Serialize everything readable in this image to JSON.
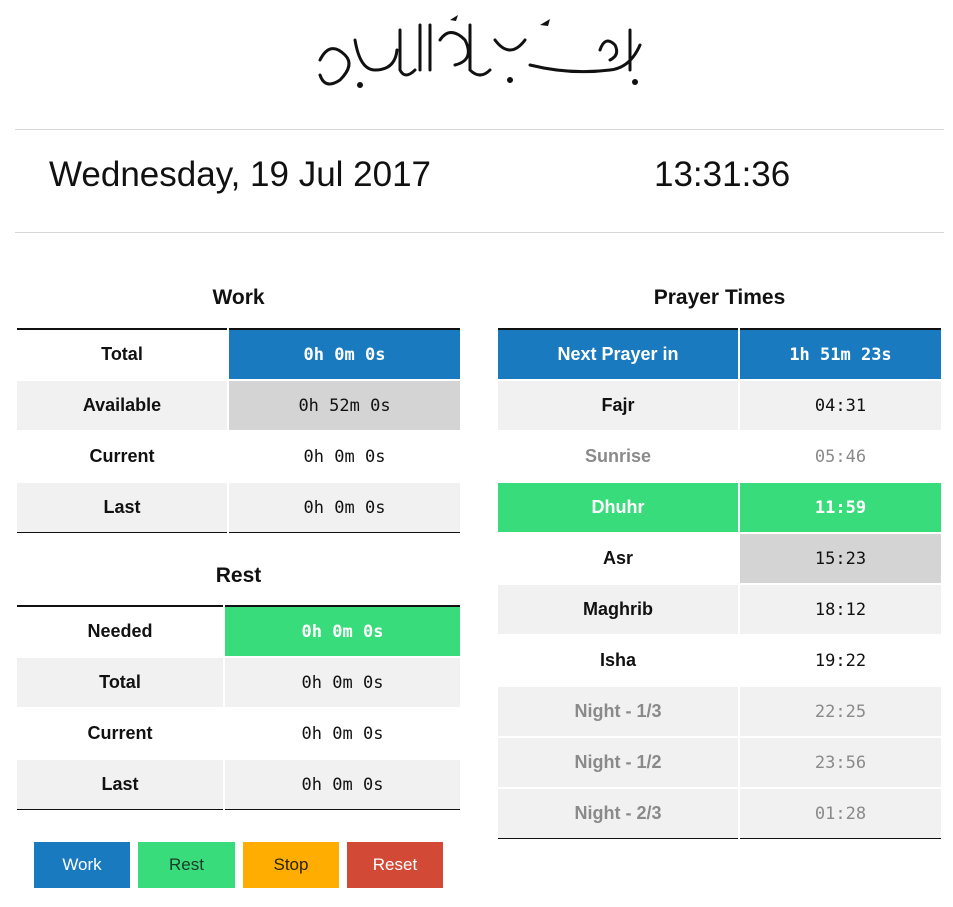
{
  "header": {
    "bismillah": "بسم الله الرحمن الرحيم"
  },
  "date_display": "Wednesday, 19 Jul 2017",
  "clock": "13:31:36",
  "work": {
    "title": "Work",
    "rows": [
      {
        "label": "Total",
        "value": "0h 0m 0s"
      },
      {
        "label": "Available",
        "value": "0h 52m 0s"
      },
      {
        "label": "Current",
        "value": "0h 0m 0s"
      },
      {
        "label": "Last",
        "value": "0h 0m 0s"
      }
    ]
  },
  "rest": {
    "title": "Rest",
    "rows": [
      {
        "label": "Needed",
        "value": "0h 0m 0s"
      },
      {
        "label": "Total",
        "value": "0h 0m 0s"
      },
      {
        "label": "Current",
        "value": "0h 0m 0s"
      },
      {
        "label": "Last",
        "value": "0h 0m 0s"
      }
    ]
  },
  "prayer": {
    "title": "Prayer Times",
    "next_label": "Next Prayer in",
    "next_value": "1h 51m 23s",
    "rows": [
      {
        "label": "Fajr",
        "value": "04:31"
      },
      {
        "label": "Sunrise",
        "value": "05:46"
      },
      {
        "label": "Dhuhr",
        "value": "11:59"
      },
      {
        "label": "Asr",
        "value": "15:23"
      },
      {
        "label": "Maghrib",
        "value": "18:12"
      },
      {
        "label": "Isha",
        "value": "19:22"
      },
      {
        "label": "Night - 1/3",
        "value": "22:25"
      },
      {
        "label": "Night - 1/2",
        "value": "23:56"
      },
      {
        "label": "Night - 2/3",
        "value": "01:28"
      }
    ]
  },
  "buttons": {
    "work": "Work",
    "rest": "Rest",
    "stop": "Stop",
    "reset": "Reset"
  },
  "colors": {
    "blue": "#1a7ac0",
    "green": "#39dc7a",
    "orange": "#ffad00",
    "red": "#d24a35",
    "grey": "#d4d4d4"
  }
}
